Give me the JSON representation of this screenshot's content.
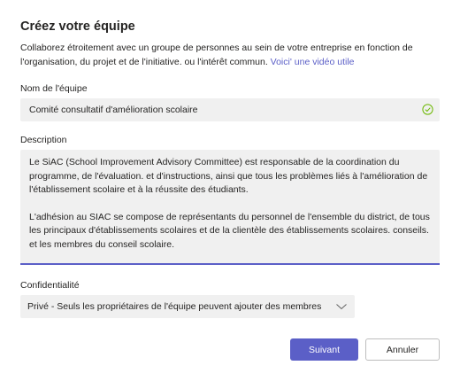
{
  "dialog": {
    "title": "Créez votre équipe",
    "intro_text": "Collaborez étroitement avec un groupe de personnes au sein de votre entreprise en fonction de l'organisation, du projet et de l'initiative. ou l'intérêt commun.",
    "intro_link": "Voici' une vidéo utile"
  },
  "team_name": {
    "label": "Nom de l'équipe",
    "value": "Comité consultatif d'amélioration scolaire",
    "valid_icon": "check-circle-icon"
  },
  "description": {
    "label": "Description",
    "paragraph1": "Le SiAC (School Improvement Advisory Committee) est responsable de la coordination du programme, de l'évaluation. et d'instructions, ainsi que tous les problèmes liés à l'amélioration de l'établissement scolaire et à la réussite des étudiants.",
    "paragraph2": "L'adhésion au SIAC se compose de représentants du personnel de l'ensemble du district, de tous les principaux d'établissements scolaires et de la clientèle des établissements scolaires. conseils. et les membres du conseil scolaire."
  },
  "privacy": {
    "label": "Confidentialité",
    "selected": "Privé - Seuls les propriétaires de l'équipe peuvent ajouter des membres"
  },
  "buttons": {
    "next": "Suivant",
    "cancel": "Annuler"
  },
  "colors": {
    "accent": "#5b5fc7",
    "valid": "#6bb700"
  }
}
